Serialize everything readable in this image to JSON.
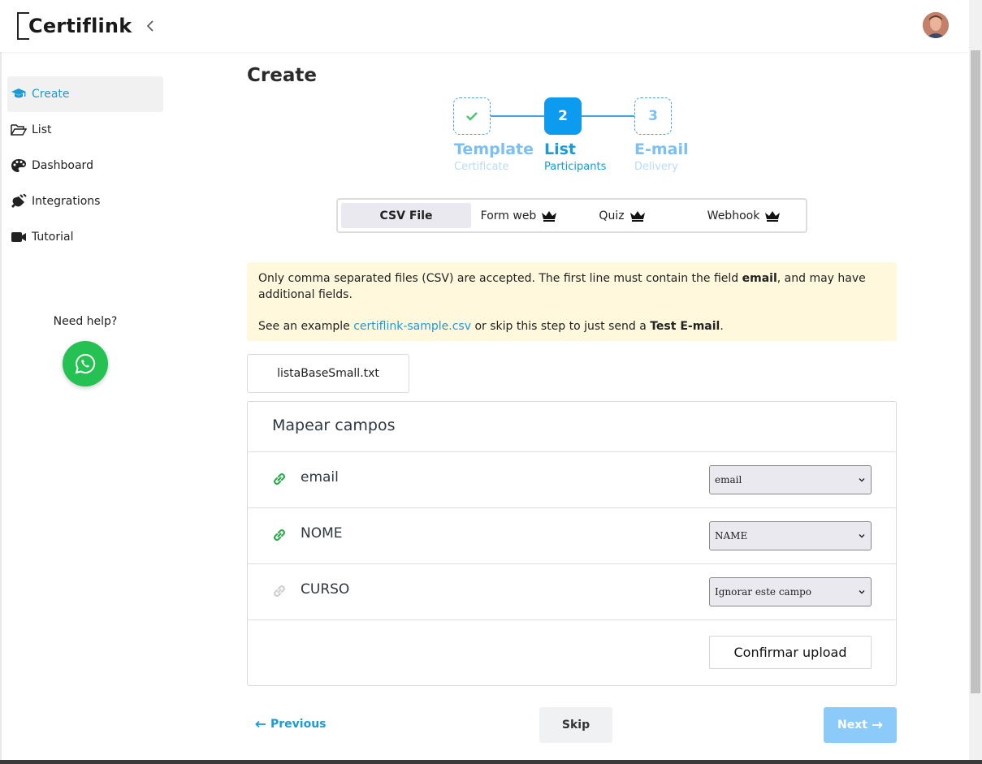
{
  "header": {
    "logo_text": "Certiflink"
  },
  "sidebar": {
    "items": [
      {
        "label": "Create",
        "icon": "graduation-cap-icon"
      },
      {
        "label": "List",
        "icon": "folder-open-icon"
      },
      {
        "label": "Dashboard",
        "icon": "palette-icon"
      },
      {
        "label": "Integrations",
        "icon": "plug-icon"
      },
      {
        "label": "Tutorial",
        "icon": "video-camera-icon"
      }
    ],
    "help_text": "Need help?"
  },
  "main": {
    "title": "Create",
    "steps": [
      {
        "number": "✓",
        "title": "Template",
        "subtitle": "Certificate",
        "state": "done"
      },
      {
        "number": "2",
        "title": "List",
        "subtitle": "Participants",
        "state": "current"
      },
      {
        "number": "3",
        "title": "E-mail",
        "subtitle": "Delivery",
        "state": "todo"
      }
    ],
    "tabs": [
      {
        "label": "CSV File",
        "premium": false
      },
      {
        "label": "Form web",
        "premium": true
      },
      {
        "label": "Quiz",
        "premium": true
      },
      {
        "label": "Webhook",
        "premium": true
      }
    ],
    "notice": {
      "line1_a": "Only comma separated files (CSV) are accepted. The first line must contain the field ",
      "line1_bold": "email",
      "line1_b": ", and may have additional fields.",
      "line2_a": "See an example ",
      "line2_link": "certiflink-sample.csv",
      "line2_b": " or skip this step to just send a ",
      "line2_bold": "Test E-mail",
      "line2_c": "."
    },
    "file_name": "listaBaseSmall.txt",
    "mapping": {
      "title": "Mapear campos",
      "rows": [
        {
          "field": "email",
          "selected": "email",
          "linked": true
        },
        {
          "field": "NOME",
          "selected": "NAME",
          "linked": true
        },
        {
          "field": "CURSO",
          "selected": "Ignorar este campo",
          "linked": false
        }
      ],
      "confirm_label": "Confirmar upload"
    },
    "nav": {
      "previous": "Previous",
      "skip": "Skip",
      "next": "Next"
    }
  },
  "colors": {
    "accent": "#1a9bd7",
    "step_current": "#0d9bf0",
    "whatsapp": "#25c153",
    "notice_bg": "#fff8dd",
    "link_green": "#2eab4f"
  }
}
